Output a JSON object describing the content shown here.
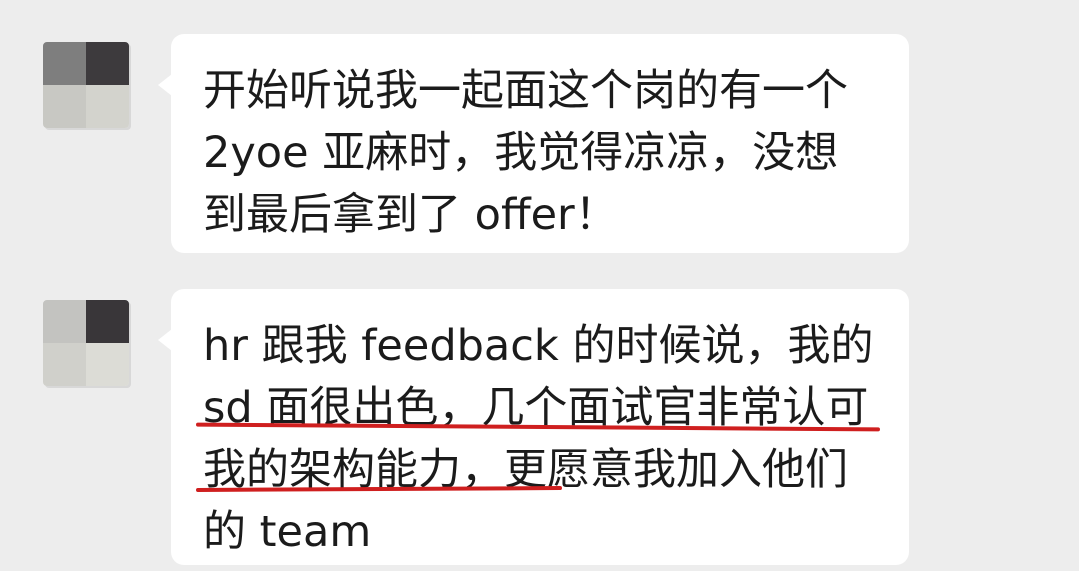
{
  "messages": [
    {
      "lines": [
        "开始听说我一起面这个岗的有一个",
        "2yoe 亚麻时，我觉得凉凉，没想",
        "到最后拿到了 offer！"
      ]
    },
    {
      "lines": [
        "hr 跟我 feedback 的时候说，我的",
        "sd 面很出色，几个面试官非常认可",
        "我的架构能力，更愿意我加入他们",
        "的 team"
      ]
    }
  ],
  "colors": {
    "background": "#ededed",
    "bubble": "#ffffff",
    "text": "#1b1b1b",
    "highlight_underline": "#cf1f1f"
  },
  "icons": {
    "avatar": "pixelated-avatar-icon"
  }
}
